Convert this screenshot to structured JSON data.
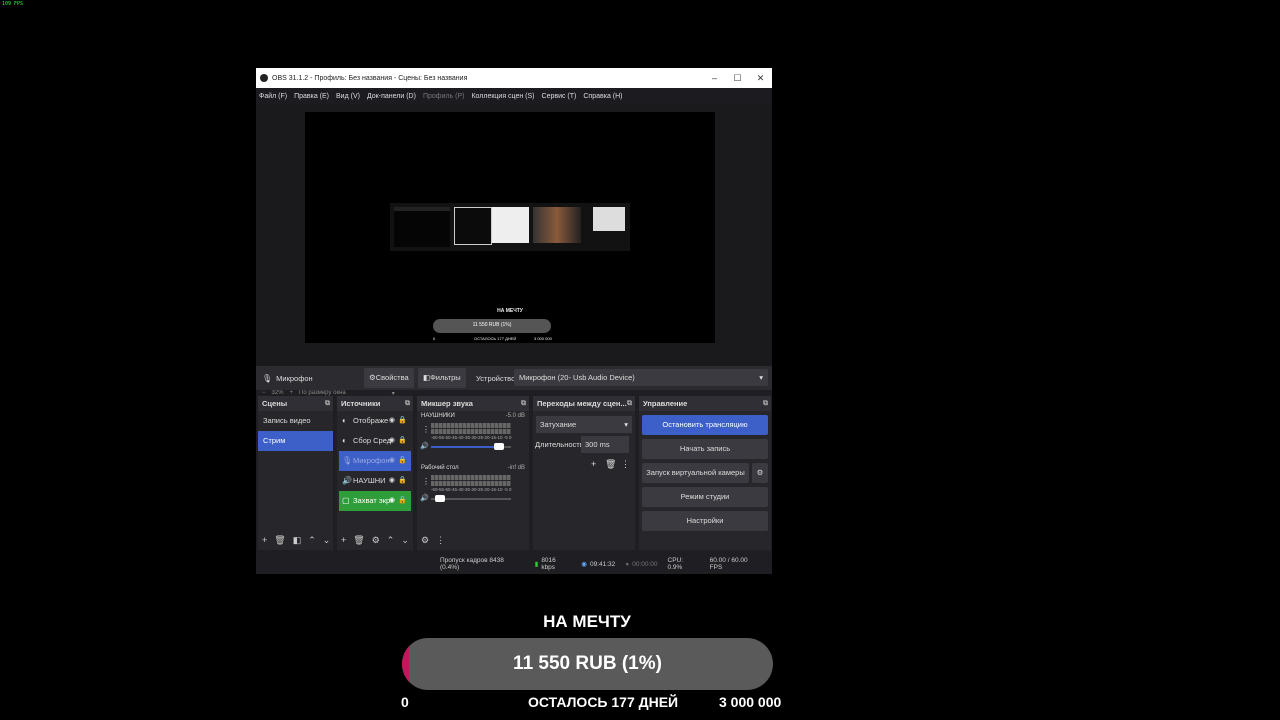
{
  "corner_fps": "109 FPS",
  "window": {
    "title": "OBS 31.1.2 - Профиль: Без названия - Сцены: Без названия",
    "minimize": "–",
    "maximize": "☐",
    "close": "✕"
  },
  "menu": [
    "Файл (F)",
    "Правка (E)",
    "Вид (V)",
    "Док-панели (D)",
    "Профиль (P)",
    "Коллекция сцен (S)",
    "Сервис (T)",
    "Справка (H)"
  ],
  "preview": {
    "mini_title": "НА МЕЧТУ",
    "mini_amount": "11 550 RUB (1%)",
    "mini_left": "0",
    "mini_mid": "ОСТАЛОСЬ 177 ДНЕЙ",
    "mini_right": "3 000 000",
    "zoom_minus": "−",
    "zoom_value": "32%",
    "zoom_plus": "+",
    "zoom_mode": "По размеру окна",
    "zoom_arrow": "▾"
  },
  "source_bar": {
    "source_name": "Микрофон",
    "properties": "Свойства",
    "filters": "Фильтры",
    "device_label": "Устройство",
    "device_value": "Микрофон (20- Usb Audio Device)"
  },
  "scenes": {
    "header": "Сцены",
    "items": [
      "Запись видео",
      "Стрим"
    ],
    "selected": 1
  },
  "sources": {
    "header": "Источники",
    "items": [
      {
        "label": "Отображе",
        "icon": "◐"
      },
      {
        "label": "Сбор Сред",
        "icon": "◐"
      },
      {
        "label": "Микрофон",
        "icon": "🎙"
      },
      {
        "label": "НАУШНИ",
        "icon": "🔊"
      },
      {
        "label": "Захват экр",
        "icon": "▢"
      }
    ]
  },
  "mixer": {
    "header": "Микшер звука",
    "channels": [
      {
        "name": "НАУШНИКИ",
        "db": "-5.0 dB",
        "level": 0.85
      },
      {
        "name": "Рабочий стол",
        "db": "-inf dB",
        "level": 0.05
      }
    ],
    "scale": "-60-55-50-45-40-35-30-25-20-15-10 -5 0"
  },
  "transitions": {
    "header": "Переходы между сцен...",
    "type": "Затухание",
    "duration_label": "Длительность",
    "duration_value": "300 ms"
  },
  "controls": {
    "header": "Управление",
    "stop_stream": "Остановить трансляцию",
    "start_recording": "Начать запись",
    "virtual_camera": "Запуск виртуальной камеры",
    "studio_mode": "Режим студии",
    "settings": "Настройки"
  },
  "status": {
    "dropped": "Пропуск кадров 8438 (0.4%)",
    "bitrate": "8016 kbps",
    "stream_time": "09:41:32",
    "rec_time": "00:00:00",
    "cpu": "CPU: 0.9%",
    "fps": "60.00 / 60.00 FPS"
  },
  "overlay": {
    "title": "НА МЕЧТУ",
    "amount": "11 550 RUB (1%)",
    "progress_percent": 1,
    "left_value": "0",
    "days_left": "ОСТАЛОСЬ 177 ДНЕЙ",
    "goal_value": "3 000 000",
    "accent": "#c2185b"
  }
}
